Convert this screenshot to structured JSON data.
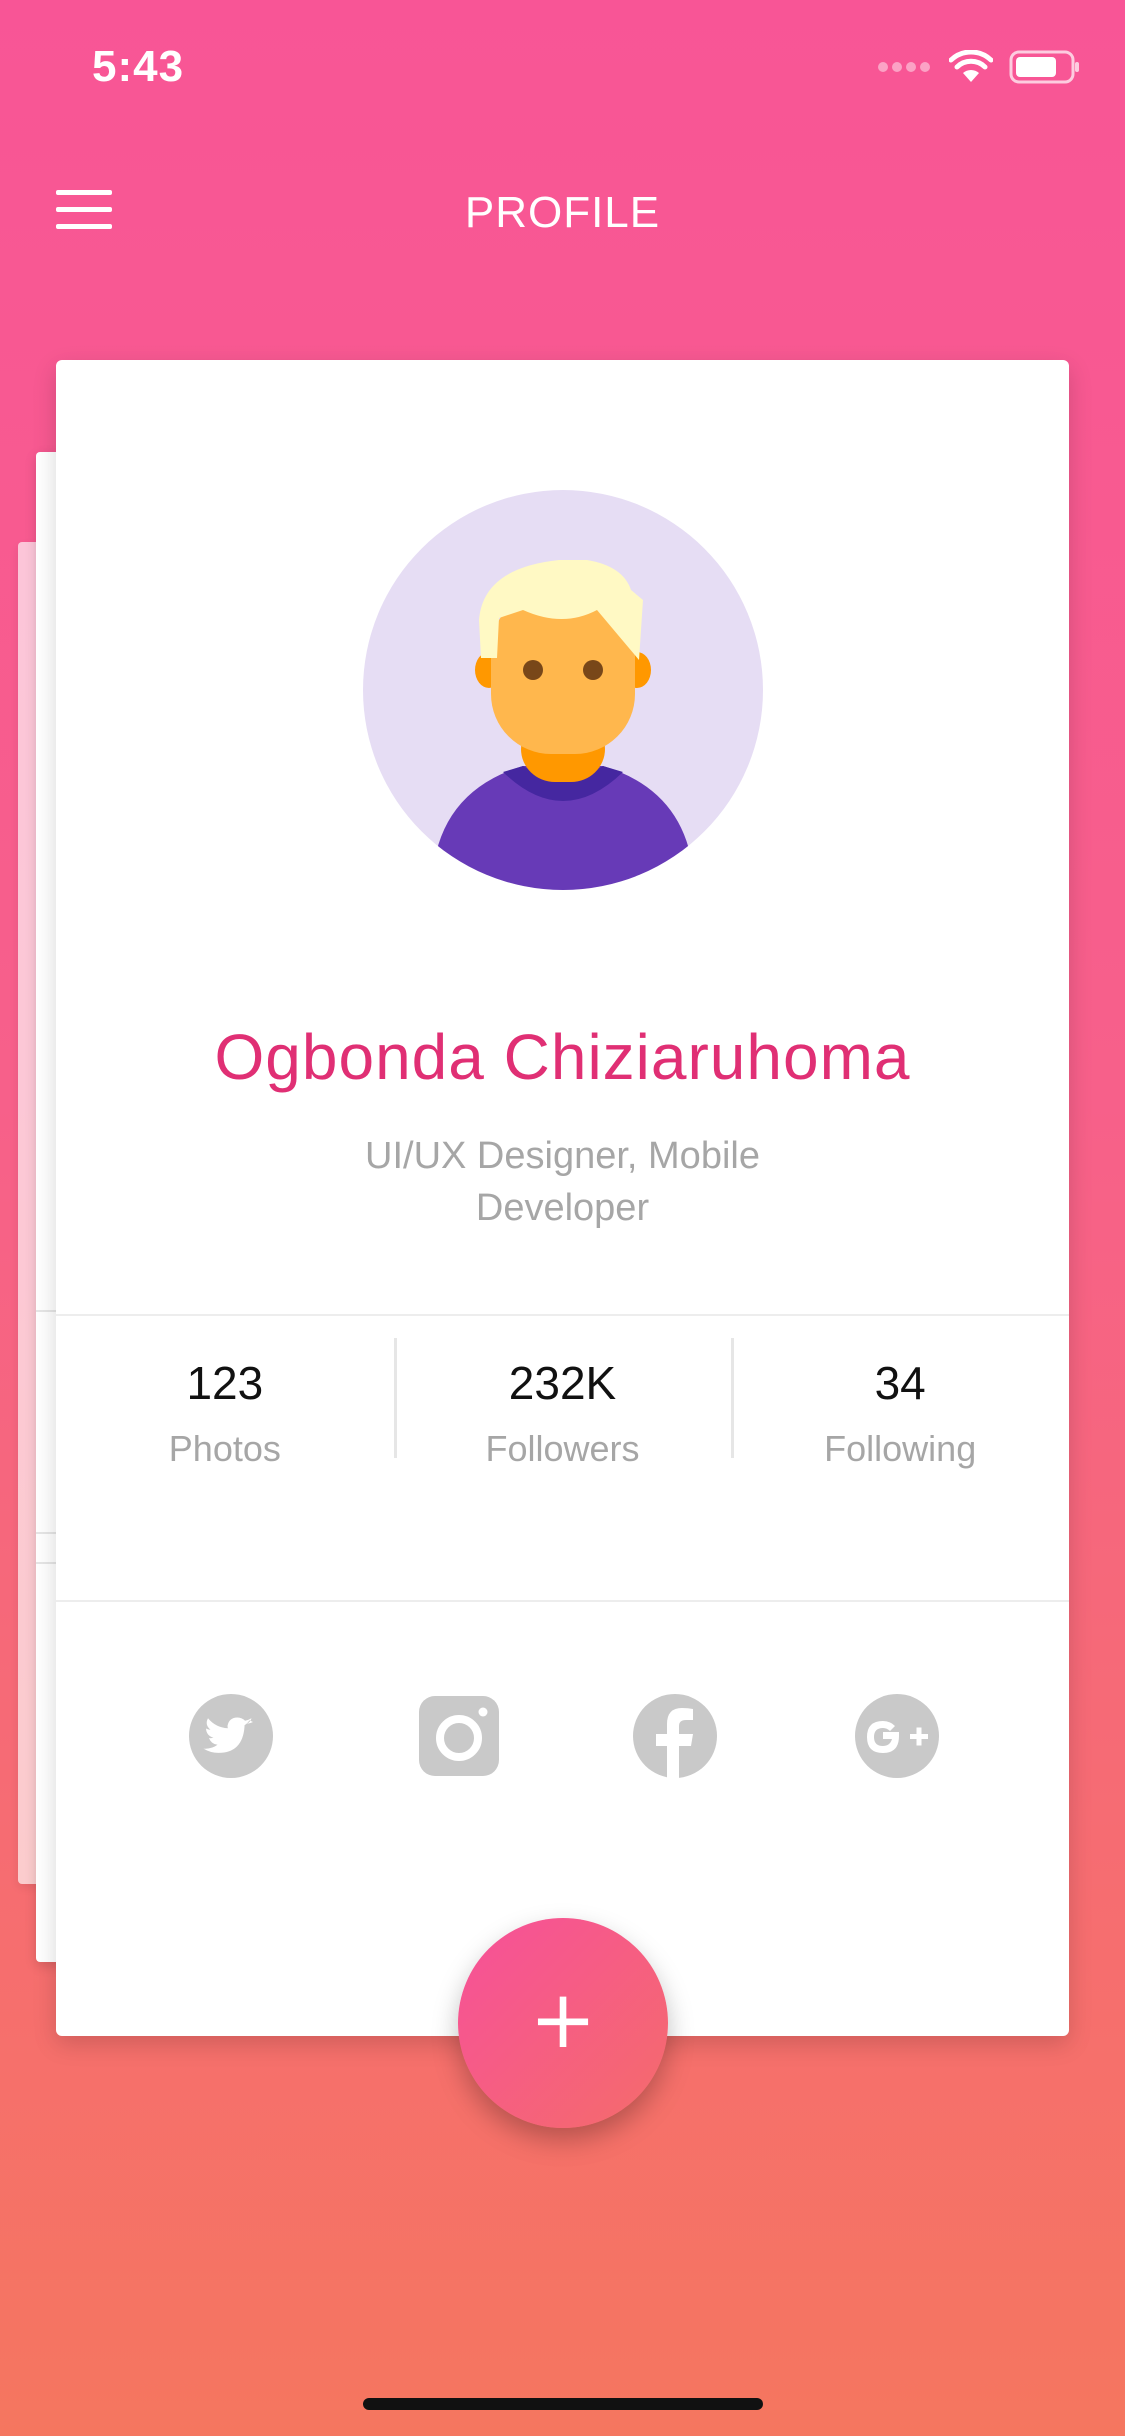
{
  "status_bar": {
    "time": "5:43",
    "icons": [
      "signal-icon",
      "wifi-icon",
      "battery-icon"
    ]
  },
  "app_bar": {
    "title": "PROFILE",
    "menu_icon": "hamburger-menu-icon"
  },
  "profile": {
    "name": "Ogbonda Chiziaruhoma",
    "role": "UI/UX Designer, Mobile Developer",
    "avatar_icon": "user-avatar-icon"
  },
  "stats": [
    {
      "value": "123",
      "label": "Photos"
    },
    {
      "value": "232K",
      "label": "Followers"
    },
    {
      "value": "34",
      "label": "Following"
    }
  ],
  "socials": [
    "twitter-icon",
    "instagram-icon",
    "facebook-icon",
    "google-plus-icon"
  ],
  "fab": {
    "label": "+",
    "icon": "plus-icon"
  },
  "colors": {
    "background_top": "#f85596",
    "background_bottom": "#f5765f",
    "accent": "#e02f74",
    "muted_text": "#a6a6a6",
    "social_icon": "#c6c6c6"
  }
}
